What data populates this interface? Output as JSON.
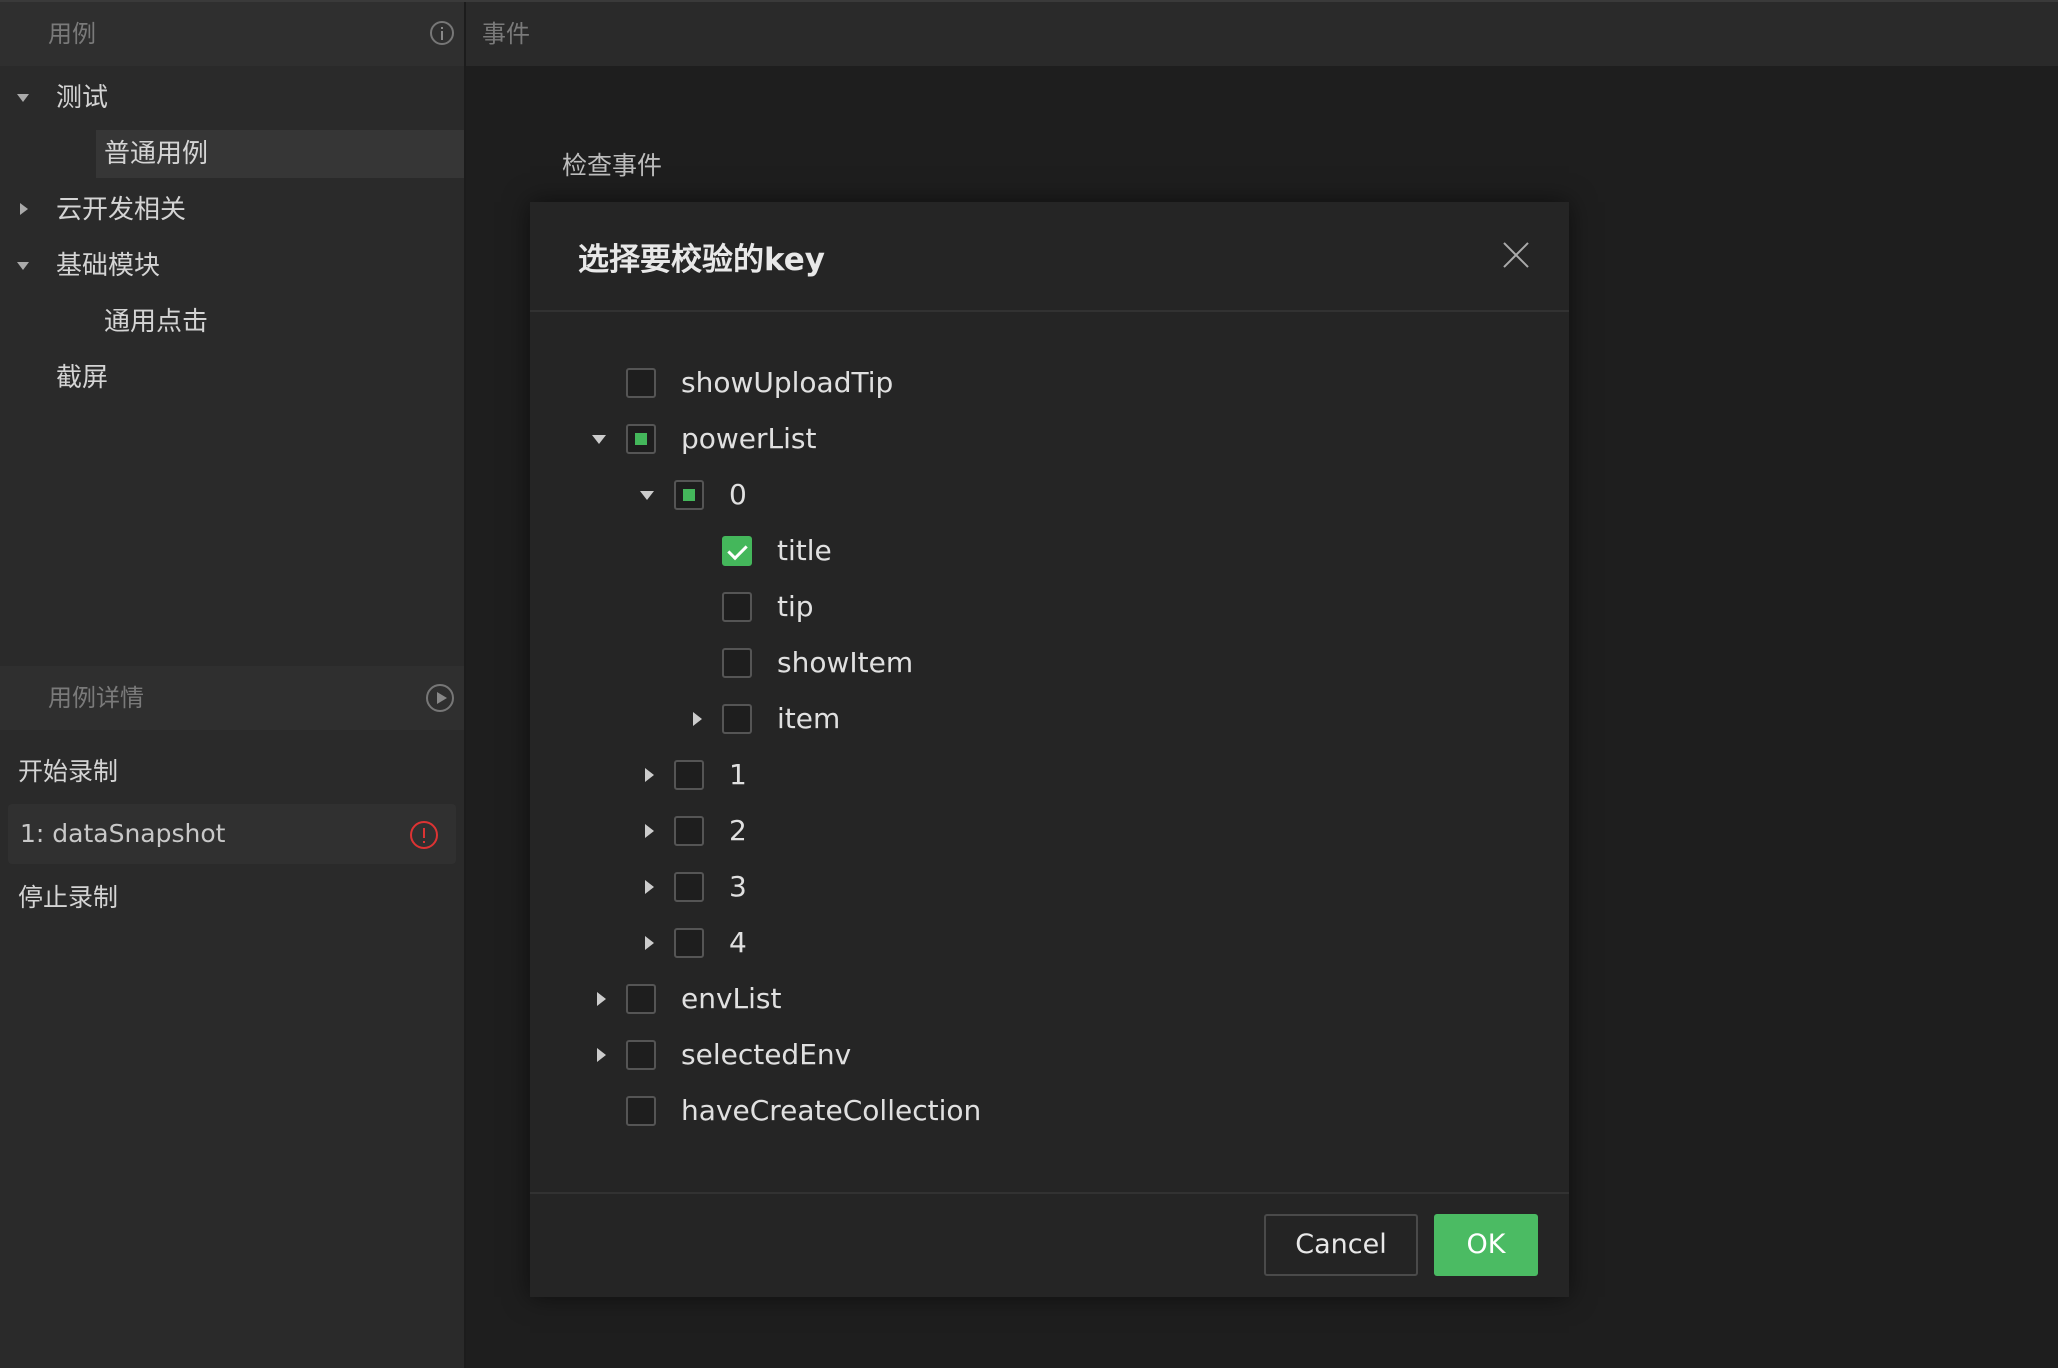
{
  "sidebar": {
    "cases_header": "用例",
    "tree": [
      {
        "label": "测试",
        "expanded": true
      },
      {
        "label": "普通用例",
        "selected": true
      },
      {
        "label": "云开发相关",
        "expanded": false
      },
      {
        "label": "基础模块",
        "expanded": true
      },
      {
        "label": "通用点击"
      },
      {
        "label": "截屏"
      }
    ],
    "detail_header": "用例详情",
    "records": {
      "start": "开始录制",
      "snapshot": "1: dataSnapshot",
      "stop": "停止录制"
    }
  },
  "main": {
    "header": "事件",
    "check_event": "检查事件"
  },
  "modal": {
    "title": "选择要校验的key",
    "items": [
      {
        "label": "showUploadTip",
        "state": "unchecked"
      },
      {
        "label": "powerList",
        "state": "partial",
        "toggle": "expanded"
      },
      {
        "label": "0",
        "state": "partial",
        "toggle": "expanded"
      },
      {
        "label": "title",
        "state": "checked"
      },
      {
        "label": "tip",
        "state": "unchecked"
      },
      {
        "label": "showItem",
        "state": "unchecked"
      },
      {
        "label": "item",
        "state": "unchecked",
        "toggle": "collapsed"
      },
      {
        "label": "1",
        "state": "unchecked",
        "toggle": "collapsed"
      },
      {
        "label": "2",
        "state": "unchecked",
        "toggle": "collapsed"
      },
      {
        "label": "3",
        "state": "unchecked",
        "toggle": "collapsed"
      },
      {
        "label": "4",
        "state": "unchecked",
        "toggle": "collapsed"
      },
      {
        "label": "envList",
        "state": "unchecked",
        "toggle": "collapsed"
      },
      {
        "label": "selectedEnv",
        "state": "unchecked",
        "toggle": "collapsed"
      },
      {
        "label": "haveCreateCollection",
        "state": "unchecked"
      }
    ],
    "cancel": "Cancel",
    "ok": "OK"
  },
  "colors": {
    "accent_green": "#4bbb63",
    "warning_red": "#dd3333"
  }
}
